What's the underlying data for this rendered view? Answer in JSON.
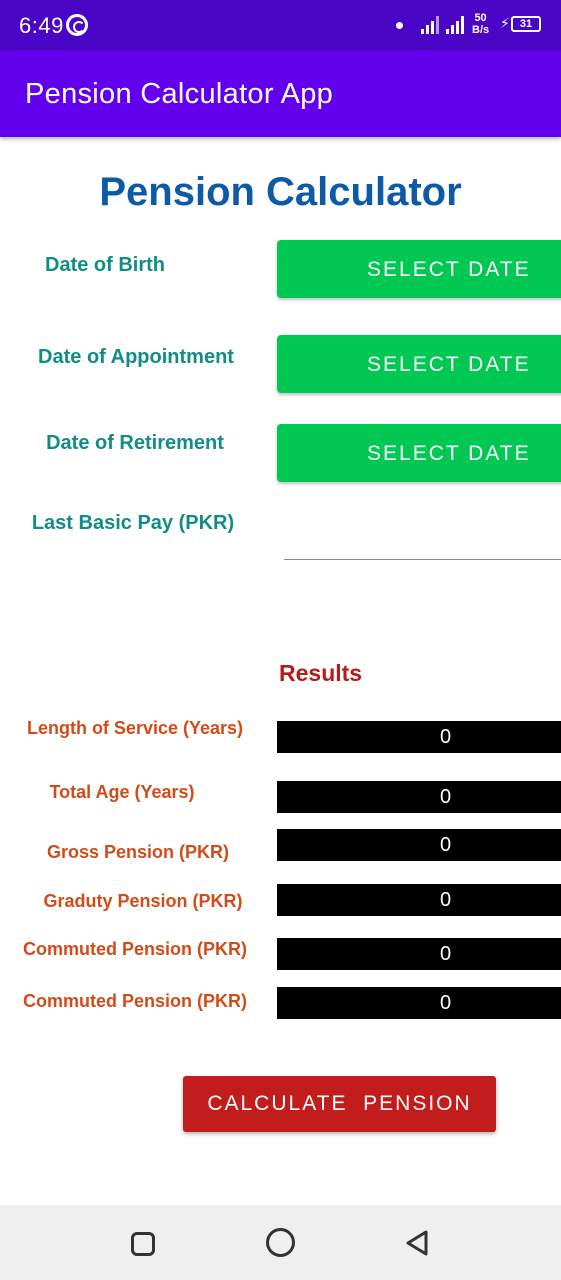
{
  "status_bar": {
    "time": "6:49",
    "net_speed_value": "50",
    "net_speed_unit": "B/s",
    "battery": "31",
    "color": "#4a06c6"
  },
  "app_bar": {
    "title": "Pension Calculator App",
    "color": "#6200ee"
  },
  "page_title": "Pension Calculator",
  "inputs": {
    "dob_label": "Date of Birth",
    "doa_label": "Date of Appointment",
    "dor_label": "Date of Retirement",
    "select_date_label": "SELECT DATE",
    "pay_label": "Last Basic Pay (PKR)",
    "pay_value": "",
    "button_color": "#00c853"
  },
  "results": {
    "title": "Results",
    "rows": [
      {
        "label": "Length of Service (Years)",
        "value": "0"
      },
      {
        "label": "Total Age (Years)",
        "value": "0"
      },
      {
        "label": "Gross Pension (PKR)",
        "value": "0"
      },
      {
        "label": "Graduty Pension (PKR)",
        "value": "0"
      },
      {
        "label": "Commuted Pension (PKR)",
        "value": "0"
      },
      {
        "label": "Commuted Pension (PKR)",
        "value": "0"
      }
    ]
  },
  "calculate_label": "CALCULATE  PENSION",
  "nav": {
    "recents_icon": "square-icon",
    "home_icon": "circle-icon",
    "back_icon": "triangle-back-icon"
  }
}
